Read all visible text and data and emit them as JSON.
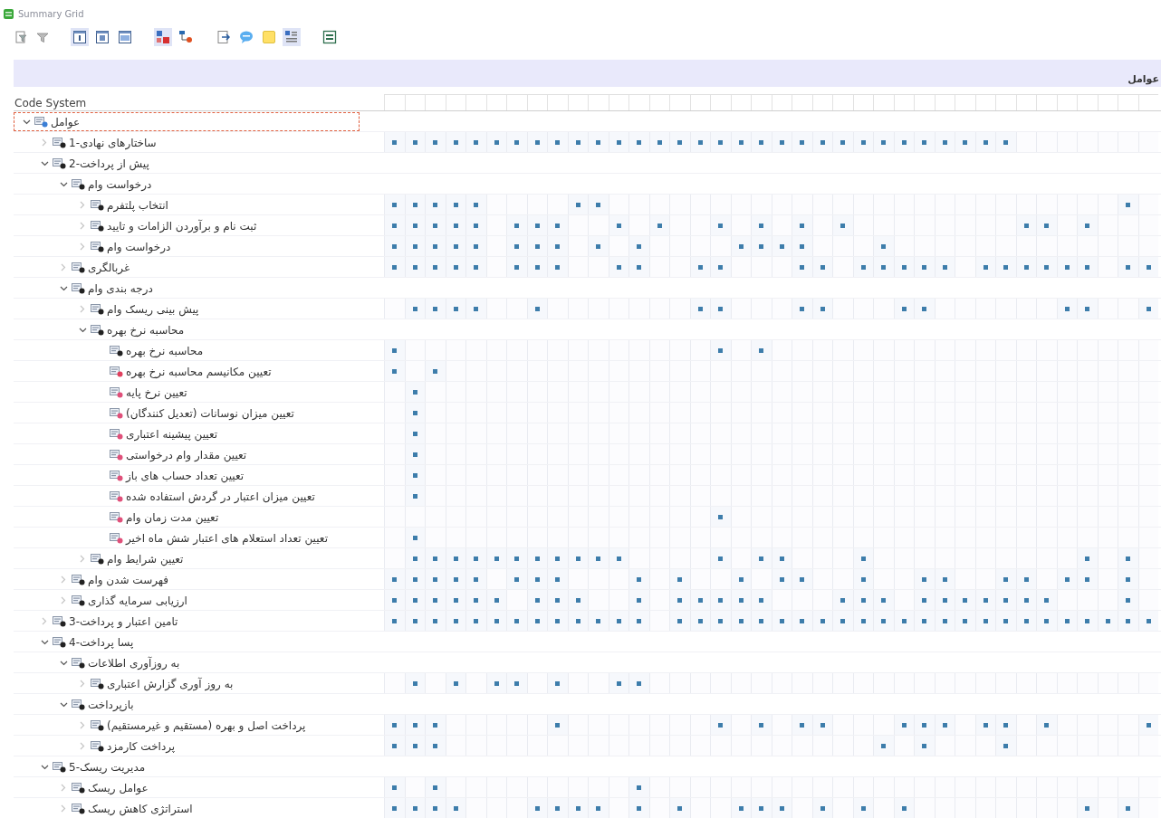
{
  "window": {
    "title": "Summary Grid"
  },
  "header": {
    "title": "عوامل"
  },
  "grid": {
    "label_heading": "Code System",
    "tree": [
      {
        "label": "عوامل",
        "color": "#3b7fd6",
        "expanded": true,
        "selected": true,
        "children": [
          {
            "label": "ساختارهای نهادی-1",
            "color": "#222222",
            "expanded": false,
            "selected": false,
            "cells": [
              true,
              true,
              true,
              true,
              true,
              true,
              true,
              true,
              true,
              true,
              true,
              true,
              true,
              true,
              true,
              true,
              true,
              true,
              true,
              true,
              true,
              true,
              true,
              true,
              true,
              true,
              true,
              true,
              true,
              true,
              true,
              false,
              false,
              false,
              false,
              false,
              false,
              false
            ]
          },
          {
            "label": "پیش از پرداخت-2",
            "color": "#222222",
            "expanded": true,
            "selected": false,
            "children": [
              {
                "label": "درخواست وام",
                "color": "#222222",
                "expanded": true,
                "selected": false,
                "children": [
                  {
                    "label": "انتخاب پلتفرم",
                    "color": "#222222",
                    "expanded": false,
                    "selected": false,
                    "cells": [
                      true,
                      true,
                      true,
                      true,
                      true,
                      false,
                      false,
                      false,
                      false,
                      true,
                      true,
                      false,
                      false,
                      false,
                      false,
                      false,
                      false,
                      false,
                      false,
                      false,
                      false,
                      false,
                      false,
                      false,
                      false,
                      false,
                      false,
                      false,
                      false,
                      false,
                      false,
                      false,
                      false,
                      false,
                      false,
                      false,
                      true,
                      false
                    ]
                  },
                  {
                    "label": "ثبت نام و برآوردن الزامات و تایید",
                    "color": "#222222",
                    "expanded": false,
                    "selected": false,
                    "cells": [
                      true,
                      true,
                      true,
                      true,
                      true,
                      false,
                      true,
                      true,
                      true,
                      false,
                      false,
                      true,
                      false,
                      true,
                      false,
                      false,
                      true,
                      false,
                      true,
                      false,
                      true,
                      false,
                      true,
                      false,
                      false,
                      false,
                      false,
                      false,
                      false,
                      false,
                      false,
                      true,
                      true,
                      false,
                      true,
                      false,
                      false,
                      false
                    ]
                  },
                  {
                    "label": "درخواست وام",
                    "color": "#222222",
                    "expanded": false,
                    "selected": false,
                    "cells": [
                      true,
                      true,
                      true,
                      true,
                      true,
                      false,
                      true,
                      true,
                      true,
                      false,
                      true,
                      false,
                      true,
                      false,
                      false,
                      false,
                      false,
                      true,
                      true,
                      true,
                      true,
                      false,
                      false,
                      false,
                      true,
                      false,
                      false,
                      false,
                      false,
                      false,
                      false,
                      false,
                      false,
                      false,
                      false,
                      false,
                      false,
                      false
                    ]
                  }
                ]
              },
              {
                "label": "غربالگری",
                "color": "#222222",
                "expanded": false,
                "selected": false,
                "cells": [
                  true,
                  true,
                  true,
                  true,
                  true,
                  false,
                  true,
                  true,
                  true,
                  false,
                  false,
                  true,
                  true,
                  false,
                  false,
                  true,
                  true,
                  false,
                  false,
                  false,
                  true,
                  true,
                  false,
                  true,
                  true,
                  true,
                  true,
                  true,
                  false,
                  true,
                  true,
                  true,
                  true,
                  true,
                  true,
                  false,
                  true,
                  true
                ]
              },
              {
                "label": "درجه بندی وام",
                "color": "#222222",
                "expanded": true,
                "selected": false,
                "children": [
                  {
                    "label": "پیش بینی ریسک وام",
                    "color": "#222222",
                    "expanded": false,
                    "selected": false,
                    "cells": [
                      false,
                      true,
                      true,
                      true,
                      true,
                      false,
                      false,
                      true,
                      false,
                      false,
                      false,
                      false,
                      false,
                      false,
                      false,
                      true,
                      true,
                      false,
                      false,
                      false,
                      true,
                      true,
                      false,
                      false,
                      false,
                      true,
                      true,
                      false,
                      false,
                      false,
                      false,
                      false,
                      false,
                      true,
                      true,
                      false,
                      false,
                      true
                    ]
                  },
                  {
                    "label": "محاسبه نرخ بهره",
                    "color": "#222222",
                    "expanded": true,
                    "selected": false,
                    "children": [
                      {
                        "label": "محاسبه نرخ بهره",
                        "color": "#222222",
                        "selected": false,
                        "cells": [
                          true,
                          false,
                          false,
                          false,
                          false,
                          false,
                          false,
                          false,
                          false,
                          false,
                          false,
                          false,
                          false,
                          false,
                          false,
                          false,
                          true,
                          false,
                          true,
                          false,
                          false,
                          false,
                          false,
                          false,
                          false,
                          false,
                          false,
                          false,
                          false,
                          false,
                          false,
                          false,
                          false,
                          false,
                          false,
                          false,
                          false,
                          false
                        ]
                      },
                      {
                        "label": "تعیین مکانیسم محاسبه نرخ بهره",
                        "color": "#e0405e",
                        "selected": false,
                        "cells": [
                          true,
                          false,
                          true,
                          false,
                          false,
                          false,
                          false,
                          false,
                          false,
                          false,
                          false,
                          false,
                          false,
                          false,
                          false,
                          false,
                          false,
                          false,
                          false,
                          false,
                          false,
                          false,
                          false,
                          false,
                          false,
                          false,
                          false,
                          false,
                          false,
                          false,
                          false,
                          false,
                          false,
                          false,
                          false,
                          false,
                          false,
                          false
                        ]
                      },
                      {
                        "label": "تعیین نرخ پایه",
                        "color": "#e0507a",
                        "selected": false,
                        "cells": [
                          false,
                          true,
                          false,
                          false,
                          false,
                          false,
                          false,
                          false,
                          false,
                          false,
                          false,
                          false,
                          false,
                          false,
                          false,
                          false,
                          false,
                          false,
                          false,
                          false,
                          false,
                          false,
                          false,
                          false,
                          false,
                          false,
                          false,
                          false,
                          false,
                          false,
                          false,
                          false,
                          false,
                          false,
                          false,
                          false,
                          false,
                          false
                        ]
                      },
                      {
                        "label": "تعیین میزان نوسانات (تعدیل کنندگان)",
                        "color": "#e0507a",
                        "selected": false,
                        "cells": [
                          false,
                          true,
                          false,
                          false,
                          false,
                          false,
                          false,
                          false,
                          false,
                          false,
                          false,
                          false,
                          false,
                          false,
                          false,
                          false,
                          false,
                          false,
                          false,
                          false,
                          false,
                          false,
                          false,
                          false,
                          false,
                          false,
                          false,
                          false,
                          false,
                          false,
                          false,
                          false,
                          false,
                          false,
                          false,
                          false,
                          false,
                          false
                        ]
                      },
                      {
                        "label": "تعیین پیشینه اعتباری",
                        "color": "#e0507a",
                        "selected": false,
                        "cells": [
                          false,
                          true,
                          false,
                          false,
                          false,
                          false,
                          false,
                          false,
                          false,
                          false,
                          false,
                          false,
                          false,
                          false,
                          false,
                          false,
                          false,
                          false,
                          false,
                          false,
                          false,
                          false,
                          false,
                          false,
                          false,
                          false,
                          false,
                          false,
                          false,
                          false,
                          false,
                          false,
                          false,
                          false,
                          false,
                          false,
                          false,
                          false
                        ]
                      },
                      {
                        "label": "تعیین مقدار وام درخواستی",
                        "color": "#e0507a",
                        "selected": false,
                        "cells": [
                          false,
                          true,
                          false,
                          false,
                          false,
                          false,
                          false,
                          false,
                          false,
                          false,
                          false,
                          false,
                          false,
                          false,
                          false,
                          false,
                          false,
                          false,
                          false,
                          false,
                          false,
                          false,
                          false,
                          false,
                          false,
                          false,
                          false,
                          false,
                          false,
                          false,
                          false,
                          false,
                          false,
                          false,
                          false,
                          false,
                          false,
                          false
                        ]
                      },
                      {
                        "label": "تعیین تعداد حساب های باز",
                        "color": "#e0507a",
                        "selected": false,
                        "cells": [
                          false,
                          true,
                          false,
                          false,
                          false,
                          false,
                          false,
                          false,
                          false,
                          false,
                          false,
                          false,
                          false,
                          false,
                          false,
                          false,
                          false,
                          false,
                          false,
                          false,
                          false,
                          false,
                          false,
                          false,
                          false,
                          false,
                          false,
                          false,
                          false,
                          false,
                          false,
                          false,
                          false,
                          false,
                          false,
                          false,
                          false,
                          false
                        ]
                      },
                      {
                        "label": "تعیین میزان اعتبار در گردش استفاده شده",
                        "color": "#e0507a",
                        "selected": false,
                        "cells": [
                          false,
                          true,
                          false,
                          false,
                          false,
                          false,
                          false,
                          false,
                          false,
                          false,
                          false,
                          false,
                          false,
                          false,
                          false,
                          false,
                          false,
                          false,
                          false,
                          false,
                          false,
                          false,
                          false,
                          false,
                          false,
                          false,
                          false,
                          false,
                          false,
                          false,
                          false,
                          false,
                          false,
                          false,
                          false,
                          false,
                          false,
                          false
                        ]
                      },
                      {
                        "label": "تعیین مدت زمان وام",
                        "color": "#e0507a",
                        "selected": false,
                        "cells": [
                          false,
                          false,
                          false,
                          false,
                          false,
                          false,
                          false,
                          false,
                          false,
                          false,
                          false,
                          false,
                          false,
                          false,
                          false,
                          false,
                          true,
                          false,
                          false,
                          false,
                          false,
                          false,
                          false,
                          false,
                          false,
                          false,
                          false,
                          false,
                          false,
                          false,
                          false,
                          false,
                          false,
                          false,
                          false,
                          false,
                          false,
                          false
                        ]
                      },
                      {
                        "label": "تعیین تعداد استعلام های اعتبار شش ماه اخیر",
                        "color": "#e0507a",
                        "selected": false,
                        "cells": [
                          false,
                          true,
                          false,
                          false,
                          false,
                          false,
                          false,
                          false,
                          false,
                          false,
                          false,
                          false,
                          false,
                          false,
                          false,
                          false,
                          false,
                          false,
                          false,
                          false,
                          false,
                          false,
                          false,
                          false,
                          false,
                          false,
                          false,
                          false,
                          false,
                          false,
                          false,
                          false,
                          false,
                          false,
                          false,
                          false,
                          false,
                          false
                        ]
                      }
                    ]
                  },
                  {
                    "label": "تعیین شرایط وام",
                    "color": "#222222",
                    "expanded": false,
                    "selected": false,
                    "cells": [
                      false,
                      true,
                      true,
                      true,
                      true,
                      true,
                      true,
                      true,
                      true,
                      true,
                      true,
                      true,
                      false,
                      false,
                      false,
                      false,
                      true,
                      false,
                      true,
                      true,
                      false,
                      false,
                      false,
                      true,
                      false,
                      false,
                      false,
                      false,
                      false,
                      false,
                      false,
                      false,
                      false,
                      false,
                      true,
                      false,
                      true,
                      false
                    ]
                  }
                ]
              },
              {
                "label": "فهرست شدن وام",
                "color": "#222222",
                "expanded": false,
                "selected": false,
                "cells": [
                  true,
                  true,
                  true,
                  true,
                  true,
                  false,
                  true,
                  true,
                  true,
                  false,
                  false,
                  false,
                  true,
                  false,
                  true,
                  false,
                  false,
                  true,
                  false,
                  true,
                  true,
                  false,
                  false,
                  true,
                  false,
                  false,
                  true,
                  true,
                  false,
                  false,
                  true,
                  true,
                  false,
                  true,
                  true,
                  false,
                  true,
                  false
                ]
              },
              {
                "label": "ارزیابی سرمایه گذاری",
                "color": "#222222",
                "expanded": false,
                "selected": false,
                "cells": [
                  true,
                  true,
                  true,
                  true,
                  true,
                  true,
                  false,
                  true,
                  true,
                  true,
                  false,
                  false,
                  true,
                  false,
                  true,
                  true,
                  true,
                  true,
                  true,
                  false,
                  false,
                  false,
                  true,
                  true,
                  true,
                  false,
                  true,
                  true,
                  true,
                  true,
                  true,
                  true,
                  true,
                  false,
                  false,
                  false,
                  true,
                  false
                ]
              }
            ]
          },
          {
            "label": "تامین اعتبار و پرداخت-3",
            "color": "#222222",
            "expanded": false,
            "selected": false,
            "cells": [
              true,
              true,
              true,
              true,
              true,
              true,
              true,
              true,
              true,
              true,
              true,
              true,
              true,
              false,
              true,
              true,
              true,
              true,
              true,
              true,
              true,
              true,
              true,
              true,
              true,
              true,
              true,
              true,
              true,
              true,
              true,
              true,
              true,
              true,
              true,
              true,
              true,
              true
            ]
          },
          {
            "label": "پسا پرداخت-4",
            "color": "#222222",
            "expanded": true,
            "selected": false,
            "children": [
              {
                "label": "به روزآوری اطلاعات",
                "color": "#222222",
                "expanded": true,
                "selected": false,
                "children": [
                  {
                    "label": "به روز آوری گزارش اعتباری",
                    "color": "#222222",
                    "expanded": false,
                    "selected": false,
                    "cells": [
                      false,
                      true,
                      false,
                      true,
                      false,
                      true,
                      true,
                      false,
                      true,
                      false,
                      false,
                      true,
                      true,
                      false,
                      false,
                      false,
                      false,
                      false,
                      false,
                      false,
                      false,
                      false,
                      false,
                      false,
                      false,
                      false,
                      false,
                      false,
                      false,
                      false,
                      false,
                      false,
                      false,
                      false,
                      false,
                      false,
                      false,
                      false
                    ]
                  }
                ]
              },
              {
                "label": "بازپرداخت",
                "color": "#222222",
                "expanded": true,
                "selected": false,
                "children": [
                  {
                    "label": "پرداخت اصل و بهره (مستقیم و غیرمستقیم)",
                    "color": "#222222",
                    "expanded": false,
                    "selected": false,
                    "cells": [
                      true,
                      true,
                      true,
                      false,
                      false,
                      false,
                      false,
                      false,
                      true,
                      false,
                      false,
                      false,
                      false,
                      false,
                      false,
                      false,
                      true,
                      false,
                      true,
                      false,
                      true,
                      true,
                      false,
                      false,
                      false,
                      true,
                      true,
                      true,
                      false,
                      true,
                      true,
                      false,
                      true,
                      false,
                      false,
                      false,
                      false,
                      true
                    ]
                  },
                  {
                    "label": "پرداخت کارمزد",
                    "color": "#222222",
                    "expanded": false,
                    "selected": false,
                    "cells": [
                      true,
                      true,
                      true,
                      false,
                      false,
                      false,
                      false,
                      false,
                      false,
                      false,
                      false,
                      false,
                      false,
                      false,
                      false,
                      false,
                      false,
                      false,
                      false,
                      false,
                      false,
                      false,
                      false,
                      false,
                      true,
                      false,
                      true,
                      false,
                      false,
                      false,
                      true,
                      false,
                      false,
                      false,
                      false,
                      false,
                      false,
                      false
                    ]
                  }
                ]
              }
            ]
          },
          {
            "label": "مدیریت ریسک-5",
            "color": "#222222",
            "expanded": true,
            "selected": false,
            "children": [
              {
                "label": "عوامل ریسک",
                "color": "#222222",
                "expanded": false,
                "selected": false,
                "cells": [
                  true,
                  false,
                  true,
                  false,
                  false,
                  false,
                  false,
                  false,
                  false,
                  false,
                  false,
                  false,
                  true,
                  false,
                  false,
                  false,
                  false,
                  false,
                  false,
                  false,
                  false,
                  false,
                  false,
                  false,
                  false,
                  false,
                  false,
                  false,
                  false,
                  false,
                  false,
                  false,
                  false,
                  false,
                  false,
                  false,
                  false,
                  false
                ]
              },
              {
                "label": "استراتژی کاهش ریسک",
                "color": "#222222",
                "expanded": false,
                "selected": false,
                "cells": [
                  true,
                  true,
                  true,
                  true,
                  false,
                  false,
                  false,
                  true,
                  true,
                  true,
                  true,
                  false,
                  true,
                  false,
                  true,
                  false,
                  false,
                  true,
                  true,
                  true,
                  false,
                  true,
                  false,
                  true,
                  false,
                  true,
                  false,
                  false,
                  false,
                  false,
                  false,
                  false,
                  false,
                  false,
                  true,
                  false,
                  true,
                  false
                ]
              }
            ]
          }
        ]
      }
    ]
  }
}
